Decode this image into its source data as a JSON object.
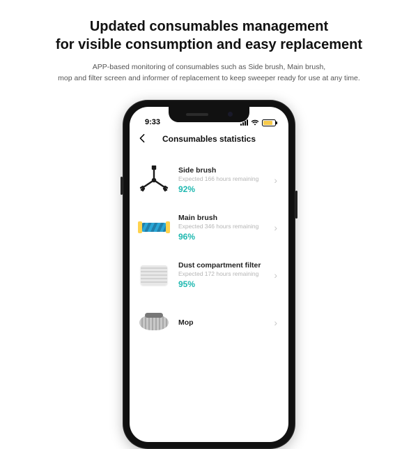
{
  "hero": {
    "title_line1": "Updated consumables management",
    "title_line2": "for visible consumption and easy replacement",
    "subtitle_line1": "APP-based monitoring of consumables such as Side brush, Main brush,",
    "subtitle_line2": "mop and filter screen and informer of replacement to keep sweeper ready for use at any time."
  },
  "statusbar": {
    "time": "9:33"
  },
  "app": {
    "header_title": "Consumables statistics"
  },
  "consumables": {
    "side_brush": {
      "name": "Side brush",
      "remaining": "Expected 166 hours remaining",
      "percent": "92%"
    },
    "main_brush": {
      "name": "Main brush",
      "remaining": "Expected 346 hours remaining",
      "percent": "96%"
    },
    "filter": {
      "name": "Dust compartment filter",
      "remaining": "Expected 172 hours remaining",
      "percent": "95%"
    },
    "mop": {
      "name": "Mop"
    }
  },
  "colors": {
    "accent": "#1fb8b0"
  }
}
